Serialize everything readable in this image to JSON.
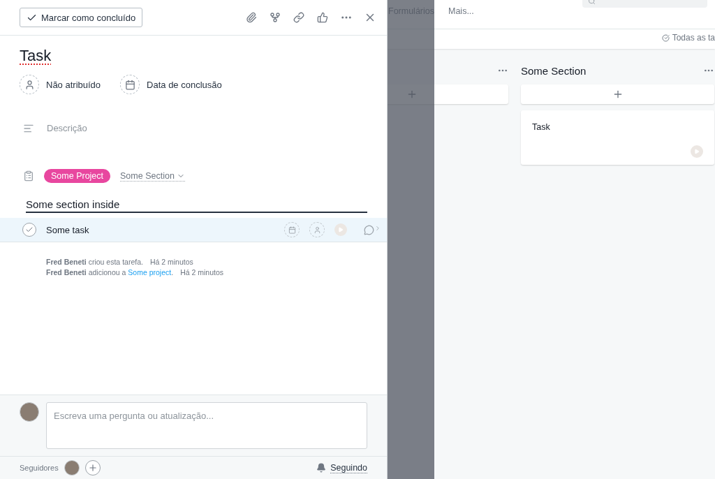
{
  "toolbar": {
    "complete_button": "Marcar como concluído"
  },
  "task": {
    "title": "Task",
    "assignee": "Não atribuído",
    "due_date": "Data de conclusão",
    "description_placeholder": "Descrição",
    "project": {
      "name": "Some Project",
      "color": "#e8479f"
    },
    "section": "Some Section"
  },
  "subtask_section": {
    "title": "Some section inside"
  },
  "subtasks": [
    {
      "name": "Some task",
      "completed": false,
      "selected": true
    }
  ],
  "activity": [
    {
      "actor": "Fred Beneti",
      "text": "criou esta tarefa.",
      "time": "Há 2 minutos"
    },
    {
      "actor": "Fred Beneti",
      "text": "adicionou a",
      "link": "Some project",
      "end": ".",
      "time": "Há 2 minutos"
    }
  ],
  "comment": {
    "placeholder": "Escreva uma pergunta ou atualização..."
  },
  "followers": {
    "label": "Seguidores",
    "following": "Seguindo"
  },
  "background": {
    "nav": [
      "Formulários",
      "Mais..."
    ],
    "filter": "Todas as ta",
    "columns": [
      {},
      {
        "title": "Some Section",
        "cards": [
          {
            "title": "Task"
          }
        ]
      }
    ]
  }
}
